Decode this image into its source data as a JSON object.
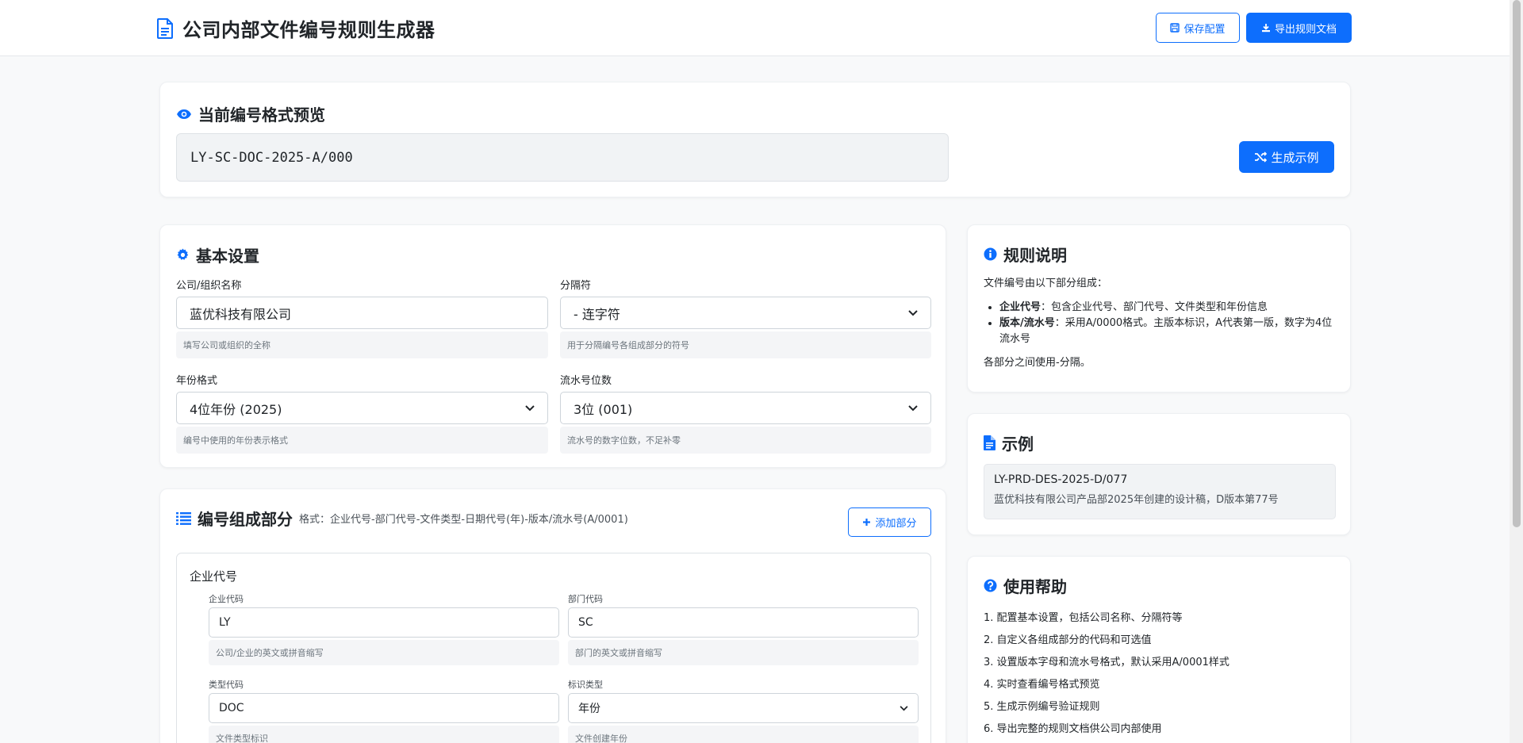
{
  "header": {
    "title": "公司内部文件编号规则生成器",
    "save_label": "保存配置",
    "export_label": "导出规则文档"
  },
  "preview": {
    "title": "当前编号格式预览",
    "value": "LY-SC-DOC-2025-A/000",
    "generate_label": "生成示例"
  },
  "basic": {
    "title": "基本设置",
    "company": {
      "label": "公司/组织名称",
      "value": "蓝优科技有限公司",
      "hint": "填写公司或组织的全称"
    },
    "separator": {
      "label": "分隔符",
      "value": "- 连字符",
      "hint": "用于分隔编号各组成部分的符号"
    },
    "year": {
      "label": "年份格式",
      "value": "4位年份 (2025)",
      "hint": "编号中使用的年份表示格式"
    },
    "serial": {
      "label": "流水号位数",
      "value": "3位 (001)",
      "hint": "流水号的数字位数，不足补零"
    }
  },
  "parts": {
    "title": "编号组成部分",
    "format": "格式：企业代号-部门代号-文件类型-日期代号(年)-版本/流水号(A/0001)",
    "add_label": "添加部分",
    "part": {
      "name": "企业代号",
      "company_code": {
        "label": "企业代码",
        "value": "LY",
        "hint": "公司/企业的英文或拼音缩写"
      },
      "dept_code": {
        "label": "部门代码",
        "value": "SC",
        "hint": "部门的英文或拼音缩写"
      },
      "type_code": {
        "label": "类型代码",
        "value": "DOC",
        "hint": "文件类型标识"
      },
      "mark_type": {
        "label": "标识类型",
        "value": "年份",
        "hint": "文件创建年份"
      }
    }
  },
  "rules": {
    "title": "规则说明",
    "intro": "文件编号由以下部分组成：",
    "item1_bold": "企业代号",
    "item1_text": "：包含企业代号、部门代号、文件类型和年份信息",
    "item2_bold": "版本/流水号",
    "item2_text": "：采用A/0000格式。主版本标识，A代表第一版，数字为4位流水号",
    "outro": "各部分之间使用-分隔。"
  },
  "example": {
    "title": "示例",
    "code": "LY-PRD-DES-2025-D/077",
    "desc": "蓝优科技有限公司产品部2025年创建的设计稿，D版本第77号"
  },
  "help": {
    "title": "使用帮助",
    "items": [
      "1. 配置基本设置，包括公司名称、分隔符等",
      "2. 自定义各组成部分的代码和可选值",
      "3. 设置版本字母和流水号格式，默认采用A/0001样式",
      "4. 实时查看编号格式预览",
      "5. 生成示例编号验证规则",
      "6. 导出完整的规则文档供公司内部使用"
    ]
  },
  "colors": {
    "accent": "#0d6efd",
    "background": "#f8f9fa"
  }
}
